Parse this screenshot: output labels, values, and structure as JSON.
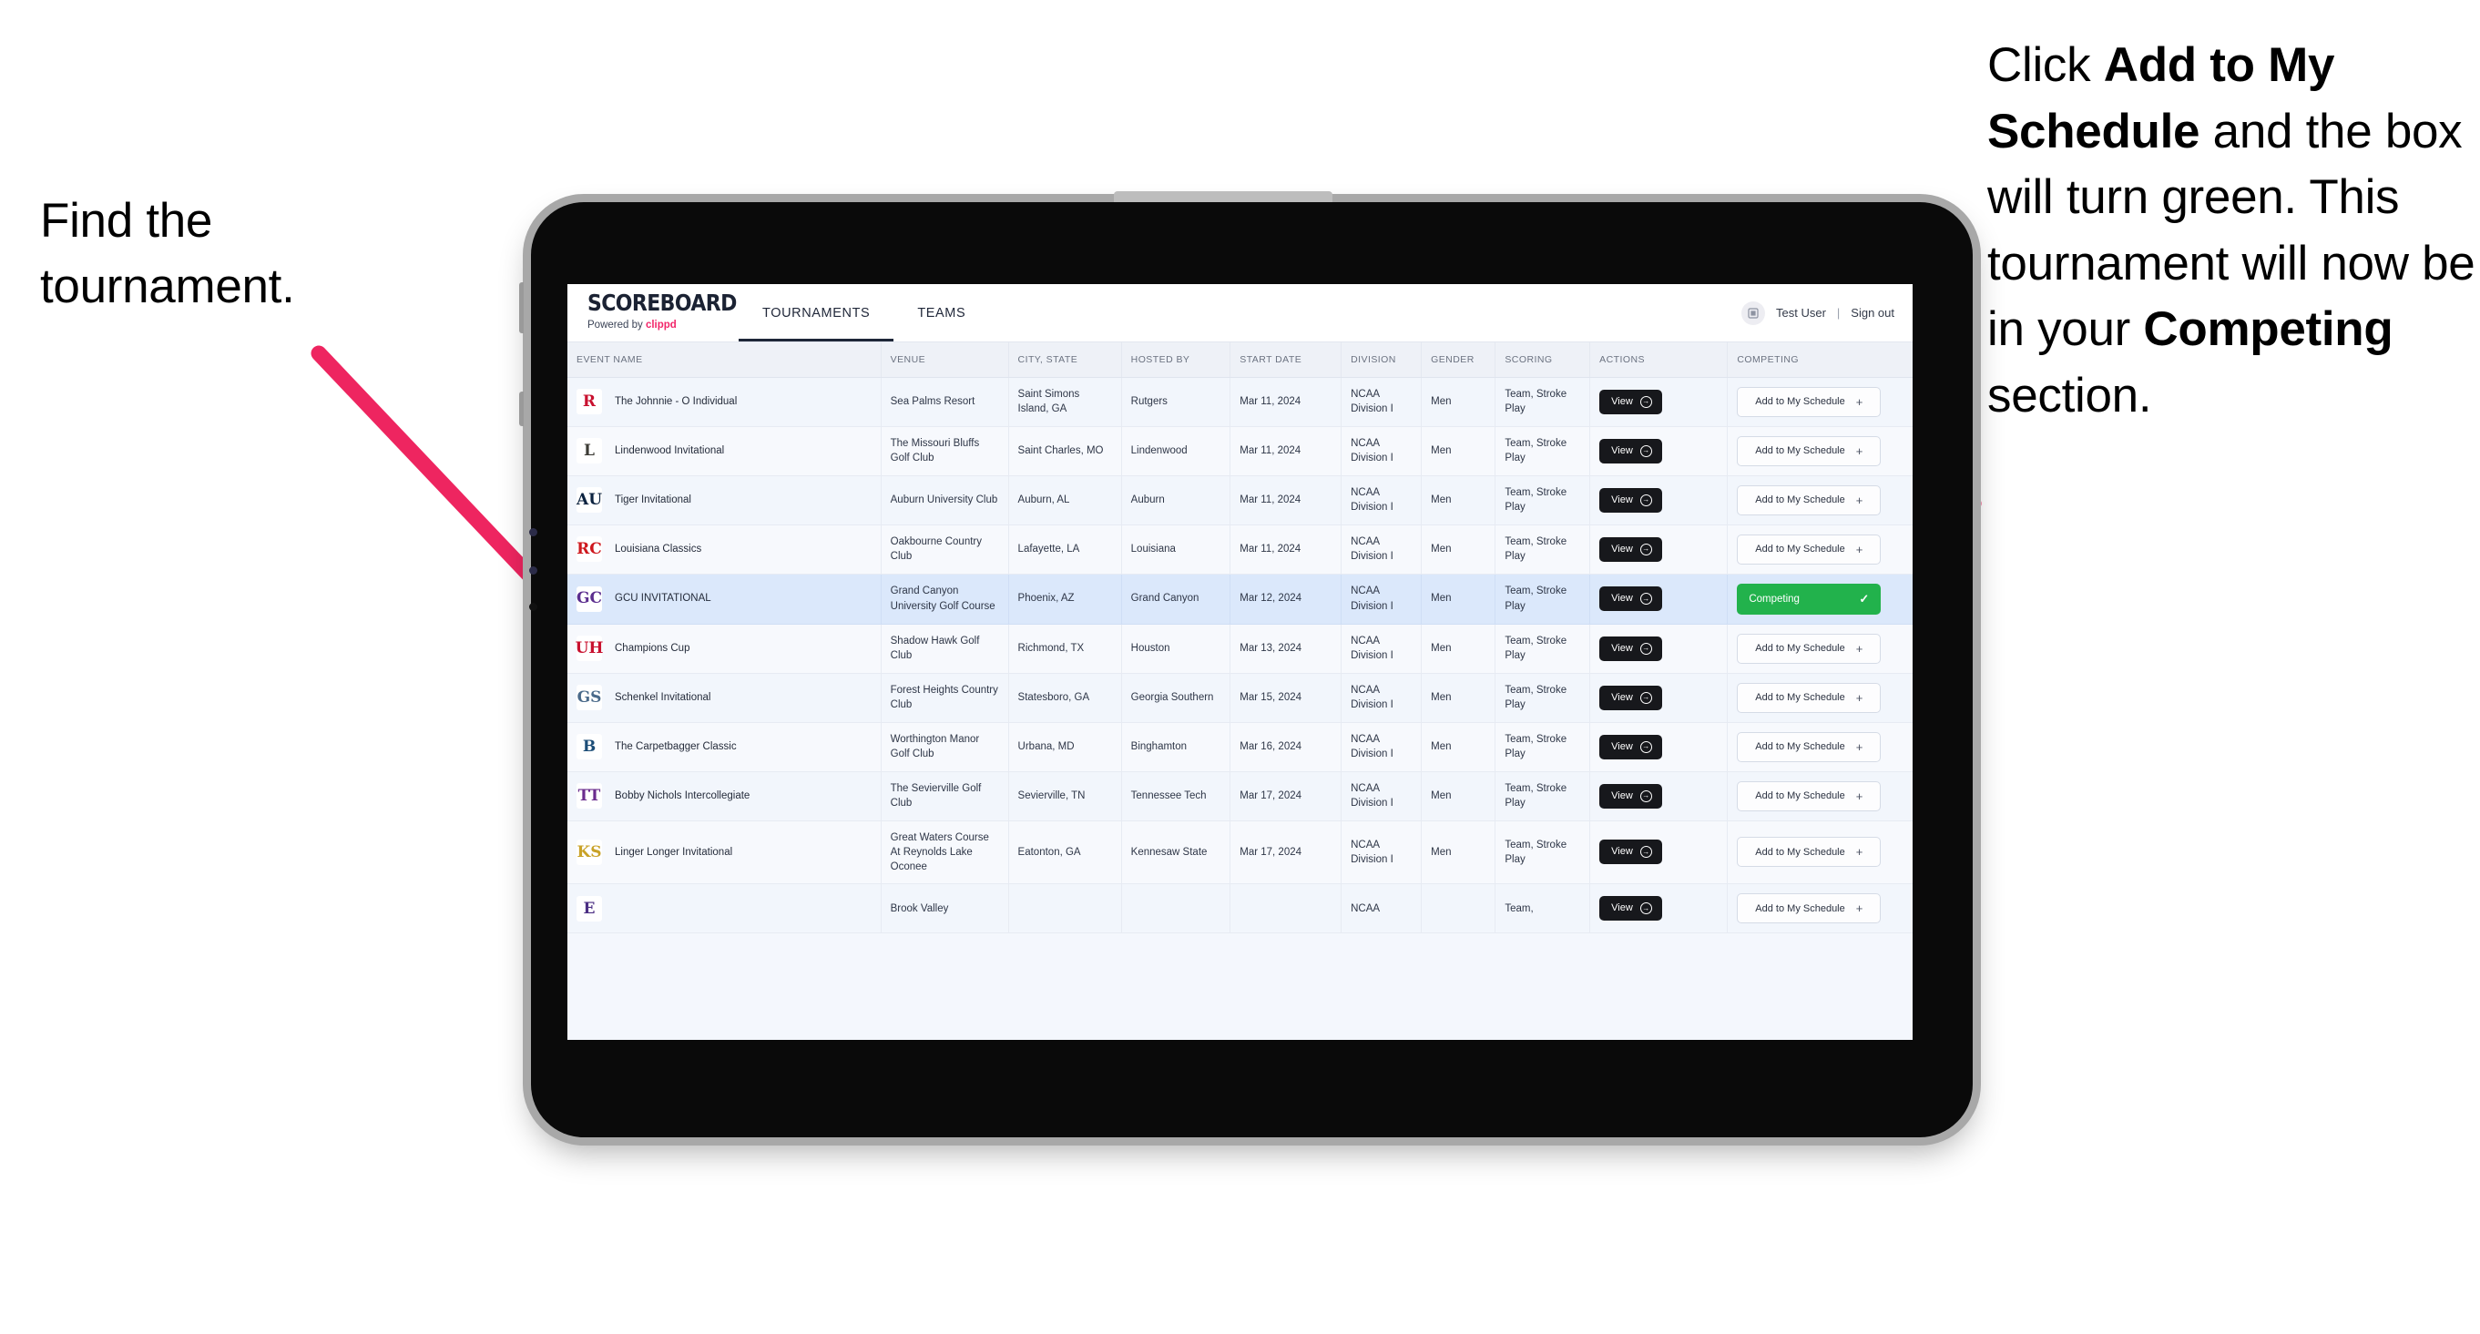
{
  "annotations": {
    "left": "Find the tournament.",
    "right_parts": [
      {
        "text": "Click ",
        "bold": false
      },
      {
        "text": "Add to My Schedule",
        "bold": true
      },
      {
        "text": " and the box will turn green. This tournament will now be in your ",
        "bold": false
      },
      {
        "text": "Competing",
        "bold": true
      },
      {
        "text": " section.",
        "bold": false
      }
    ],
    "arrow_color": "#ee2560"
  },
  "app": {
    "brand": {
      "title": "SCOREBOARD",
      "powered_prefix": "Powered by ",
      "powered_brand": "clippd"
    },
    "nav_tabs": [
      {
        "label": "TOURNAMENTS",
        "active": true
      },
      {
        "label": "TEAMS",
        "active": false
      }
    ],
    "header_right": {
      "avatar_icon": "user-avatar-icon",
      "user_name": "Test User",
      "separator": "|",
      "sign_out": "Sign out"
    }
  },
  "table": {
    "columns": [
      "EVENT NAME",
      "VENUE",
      "CITY, STATE",
      "HOSTED BY",
      "START DATE",
      "DIVISION",
      "GENDER",
      "SCORING",
      "ACTIONS",
      "COMPETING"
    ],
    "view_label": "View",
    "add_label": "Add to My Schedule",
    "competing_label": "Competing",
    "competing_color": "#22b24c",
    "rows": [
      {
        "logo": "R",
        "logo_bg": "#ffffff",
        "logo_fg": "#c8102e",
        "event": "The Johnnie - O Individual",
        "venue": "Sea Palms Resort",
        "city": "Saint Simons Island, GA",
        "host": "Rutgers",
        "date": "Mar 11, 2024",
        "division": "NCAA Division I",
        "gender": "Men",
        "scoring": "Team, Stroke Play",
        "competing": false
      },
      {
        "logo": "L",
        "logo_bg": "#ffffff",
        "logo_fg": "#3c3b35",
        "event": "Lindenwood Invitational",
        "venue": "The Missouri Bluffs Golf Club",
        "city": "Saint Charles, MO",
        "host": "Lindenwood",
        "date": "Mar 11, 2024",
        "division": "NCAA Division I",
        "gender": "Men",
        "scoring": "Team, Stroke Play",
        "competing": false
      },
      {
        "logo": "AU",
        "logo_bg": "#ffffff",
        "logo_fg": "#0c2340",
        "event": "Tiger Invitational",
        "venue": "Auburn University Club",
        "city": "Auburn, AL",
        "host": "Auburn",
        "date": "Mar 11, 2024",
        "division": "NCAA Division I",
        "gender": "Men",
        "scoring": "Team, Stroke Play",
        "competing": false
      },
      {
        "logo": "RC",
        "logo_bg": "#ffffff",
        "logo_fg": "#ce181e",
        "event": "Louisiana Classics",
        "venue": "Oakbourne Country Club",
        "city": "Lafayette, LA",
        "host": "Louisiana",
        "date": "Mar 11, 2024",
        "division": "NCAA Division I",
        "gender": "Men",
        "scoring": "Team, Stroke Play",
        "competing": false
      },
      {
        "logo": "GC",
        "logo_bg": "#ffffff",
        "logo_fg": "#5b2d8e",
        "event": "GCU INVITATIONAL",
        "venue": "Grand Canyon University Golf Course",
        "city": "Phoenix, AZ",
        "host": "Grand Canyon",
        "date": "Mar 12, 2024",
        "division": "NCAA Division I",
        "gender": "Men",
        "scoring": "Team, Stroke Play",
        "competing": true,
        "highlight": true
      },
      {
        "logo": "UH",
        "logo_bg": "#ffffff",
        "logo_fg": "#c8102e",
        "event": "Champions Cup",
        "venue": "Shadow Hawk Golf Club",
        "city": "Richmond, TX",
        "host": "Houston",
        "date": "Mar 13, 2024",
        "division": "NCAA Division I",
        "gender": "Men",
        "scoring": "Team, Stroke Play",
        "competing": false
      },
      {
        "logo": "GS",
        "logo_bg": "#ffffff",
        "logo_fg": "#4a6a8a",
        "event": "Schenkel Invitational",
        "venue": "Forest Heights Country Club",
        "city": "Statesboro, GA",
        "host": "Georgia Southern",
        "date": "Mar 15, 2024",
        "division": "NCAA Division I",
        "gender": "Men",
        "scoring": "Team, Stroke Play",
        "competing": false
      },
      {
        "logo": "B",
        "logo_bg": "#ffffff",
        "logo_fg": "#1c4d77",
        "event": "The Carpetbagger Classic",
        "venue": "Worthington Manor Golf Club",
        "city": "Urbana, MD",
        "host": "Binghamton",
        "date": "Mar 16, 2024",
        "division": "NCAA Division I",
        "gender": "Men",
        "scoring": "Team, Stroke Play",
        "competing": false
      },
      {
        "logo": "TT",
        "logo_bg": "#ffffff",
        "logo_fg": "#6b2d8e",
        "event": "Bobby Nichols Intercollegiate",
        "venue": "The Sevierville Golf Club",
        "city": "Sevierville, TN",
        "host": "Tennessee Tech",
        "date": "Mar 17, 2024",
        "division": "NCAA Division I",
        "gender": "Men",
        "scoring": "Team, Stroke Play",
        "competing": false
      },
      {
        "logo": "KS",
        "logo_bg": "#ffffff",
        "logo_fg": "#c9a227",
        "event": "Linger Longer Invitational",
        "venue": "Great Waters Course At Reynolds Lake Oconee",
        "city": "Eatonton, GA",
        "host": "Kennesaw State",
        "date": "Mar 17, 2024",
        "division": "NCAA Division I",
        "gender": "Men",
        "scoring": "Team, Stroke Play",
        "competing": false
      },
      {
        "logo": "E",
        "logo_bg": "#ffffff",
        "logo_fg": "#4b2e83",
        "event": "",
        "venue": "Brook Valley",
        "city": "",
        "host": "",
        "date": "",
        "division": "NCAA",
        "gender": "",
        "scoring": "Team,",
        "competing": false,
        "clipped": true
      }
    ]
  }
}
